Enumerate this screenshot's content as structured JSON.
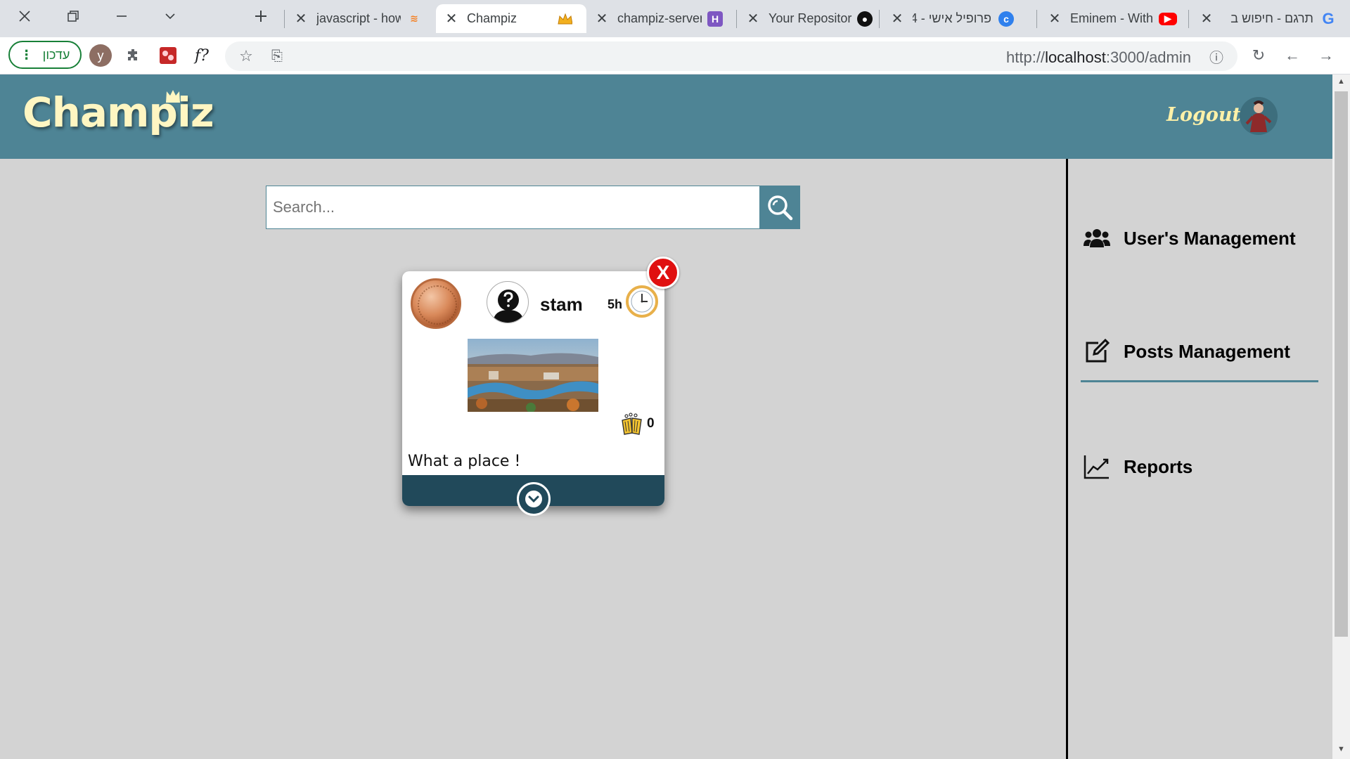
{
  "browser": {
    "tabs": [
      {
        "title": "javascript - how"
      },
      {
        "title": "Champiz"
      },
      {
        "title": "champiz-server"
      },
      {
        "title": "Your Repositor"
      },
      {
        "title": "פרופיל אישי - 4"
      },
      {
        "title": "Eminem - With"
      },
      {
        "title": "תרגם - חיפוש ב"
      }
    ],
    "url_prefix": "http://",
    "url_host": "localhost",
    "url_path": ":3000/admin",
    "update_label": "עדכון",
    "profile_initial": "y",
    "ext_label": "f?"
  },
  "header": {
    "logo": "Champiz",
    "logout": "Logout"
  },
  "search": {
    "placeholder": "Search..."
  },
  "sidebar": {
    "items": [
      {
        "label": "User's Management",
        "icon": "users-icon"
      },
      {
        "label": "Posts Management",
        "icon": "edit-icon",
        "active": true
      },
      {
        "label": "Reports",
        "icon": "chart-line-icon"
      }
    ]
  },
  "post": {
    "close_label": "X",
    "username": "stam",
    "time": "5h",
    "likes": "0",
    "text": "What a place !"
  },
  "colors": {
    "header": "#4e8495",
    "card_footer": "#21495a",
    "close": "#e01010",
    "logo": "#fff6c2"
  }
}
